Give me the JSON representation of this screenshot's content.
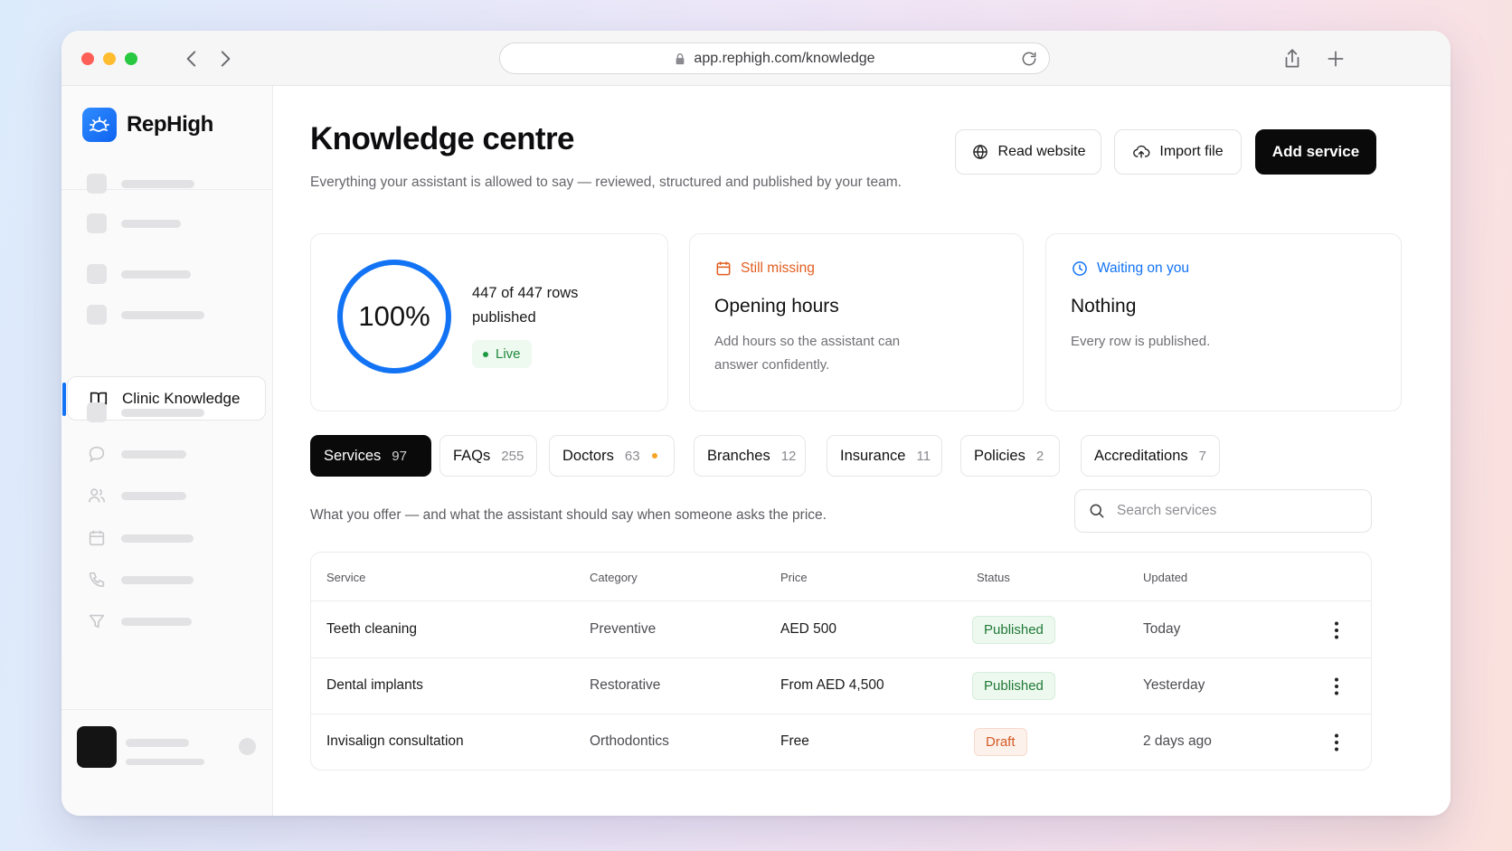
{
  "browser": {
    "url": "app.rephigh.com/knowledge"
  },
  "sidebar": {
    "brand": "RepHigh",
    "active_item": "Clinic Knowledge"
  },
  "header": {
    "title": "Knowledge centre",
    "subtitle": "Everything your assistant is allowed to say — reviewed, structured and published by your team.",
    "read_website_label": "Read website",
    "import_file_label": "Import file",
    "add_service_label": "Add service"
  },
  "stats": {
    "progress": {
      "percent": 100,
      "percent_label": "100%",
      "rows_text": "447 of 447 rows published",
      "status": "Live"
    },
    "missing": {
      "kicker": "Still missing",
      "title": "Opening hours",
      "body": "Add hours so the assistant can answer confidently."
    },
    "waiting": {
      "kicker": "Waiting on you",
      "title": "Nothing",
      "body": "Every row is published."
    }
  },
  "tabs": [
    {
      "label": "Services",
      "count": "97"
    },
    {
      "label": "FAQs",
      "count": "255"
    },
    {
      "label": "Doctors",
      "count": "63"
    },
    {
      "label": "Branches",
      "count": "12"
    },
    {
      "label": "Insurance",
      "count": "11"
    },
    {
      "label": "Policies",
      "count": "2"
    },
    {
      "label": "Accreditations",
      "count": "7"
    }
  ],
  "services": {
    "description": "What you offer — and what the assistant should say when someone asks the price.",
    "search_placeholder": "Search services",
    "columns": [
      "Service",
      "Category",
      "Price",
      "Status",
      "Updated"
    ],
    "rows": [
      {
        "service": "Teeth cleaning",
        "category": "Preventive",
        "price": "AED 500",
        "status": "Published",
        "updated": "Today"
      },
      {
        "service": "Dental implants",
        "category": "Restorative",
        "price": "From AED 4,500",
        "status": "Published",
        "updated": "Yesterday"
      },
      {
        "service": "Invisalign consultation",
        "category": "Orthodontics",
        "price": "Free",
        "status": "Draft",
        "updated": "2 days ago"
      }
    ]
  },
  "colors": {
    "accent": "#1273f5",
    "primary_button": "#0a0a0a",
    "missing": "#e25d1f",
    "waiting": "#1273f5",
    "published": "#1f7a36",
    "draft": "#d45a25",
    "warning_dot": "#f5a524"
  },
  "icons": {
    "read_website": "globe-icon",
    "import_file": "cloud-upload-icon",
    "missing": "calendar-icon",
    "waiting": "clock-icon",
    "active_nav": "book-open-icon"
  }
}
